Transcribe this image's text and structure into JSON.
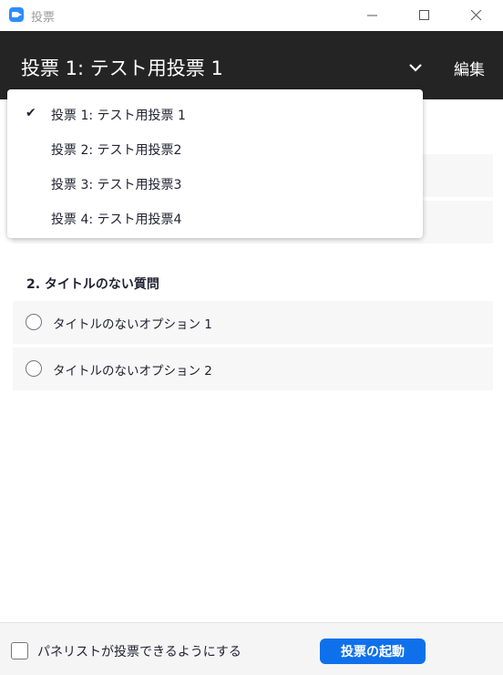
{
  "window": {
    "title": "投票",
    "icon": "zoom-app-icon"
  },
  "header": {
    "title": "投票 1: テスト用投票 1",
    "edit_label": "編集"
  },
  "dropdown": {
    "items": [
      {
        "label": "投票 1: テスト用投票 1",
        "selected": true
      },
      {
        "label": "投票 2: テスト用投票2",
        "selected": false
      },
      {
        "label": "投票 3: テスト用投票3",
        "selected": false
      },
      {
        "label": "投票 4: テスト用投票4",
        "selected": false
      }
    ],
    "check_glyph": "✔"
  },
  "question2": {
    "title": "2. タイトルのない質問",
    "options": [
      "タイトルのないオプション 1",
      "タイトルのないオプション 2"
    ]
  },
  "footer": {
    "checkbox_label": "パネリストが投票できるようにする",
    "launch_label": "投票の起動"
  },
  "colors": {
    "header_bg": "#242424",
    "accent": "#0e71eb",
    "row_bg": "#f7f7f7"
  }
}
